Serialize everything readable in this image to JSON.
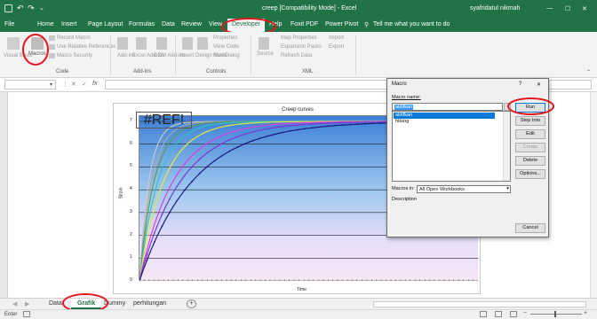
{
  "window": {
    "title": "creep [Compatibility Mode] - Excel",
    "user": "syafridatul nikmah"
  },
  "tabs": [
    "File",
    "Home",
    "Insert",
    "Page Layout",
    "Formulas",
    "Data",
    "Review",
    "View",
    "Developer",
    "Help",
    "Foxit PDF",
    "Power Pivot"
  ],
  "active_tab": "Developer",
  "tell_me": "Tell me what you want to do",
  "ribbon": {
    "code_group": {
      "label": "Code",
      "items": [
        "Visual Basic",
        "Macros",
        "Record Macro",
        "Use Relative References",
        "Macro Security"
      ]
    },
    "addins_group": {
      "label": "Add-ins",
      "items": [
        "Add-ins",
        "Excel Add-ins",
        "COM Add-ins"
      ]
    },
    "controls_group": {
      "label": "Controls",
      "items": [
        "Insert",
        "Design Mode",
        "Properties",
        "View Code",
        "Run Dialog"
      ]
    },
    "xml_group": {
      "label": "XML",
      "items": [
        "Source",
        "Map Properties",
        "Expansion Packs",
        "Refresh Data",
        "Import",
        "Export"
      ]
    }
  },
  "formula_bar": {
    "name_box": "",
    "fx": "fx"
  },
  "chart_data": {
    "type": "line",
    "title": "Creep curves",
    "xlabel": "Time",
    "ylabel": "Strain",
    "ylim": [
      0,
      7
    ],
    "yticks": [
      0,
      1,
      2,
      3,
      4,
      5,
      6,
      7
    ],
    "annotation": "#REF!",
    "series": [
      {
        "color": "#c8c8c8",
        "rate": 6.0
      },
      {
        "color": "#a8a8a8",
        "rate": 4.6
      },
      {
        "color": "#5a9a5a",
        "rate": 3.8
      },
      {
        "color": "#2ec4c4",
        "rate": 3.0
      },
      {
        "color": "#e8e83a",
        "rate": 2.3
      },
      {
        "color": "#e03ce0",
        "rate": 1.65
      },
      {
        "color": "#7a3ad0",
        "rate": 1.35
      },
      {
        "color": "#1b1b80",
        "rate": 1.05
      }
    ]
  },
  "sheet_tabs": [
    "Data",
    "Grafik",
    "Dummy",
    "perhitungan"
  ],
  "active_sheet": "Grafik",
  "status": {
    "mode": "Enter"
  },
  "macro_dialog": {
    "title": "Macro",
    "help": "?",
    "close": "✕",
    "macro_name_label": "Macro name:",
    "macro_name_value": "aktifkan",
    "macros": [
      "aktifkan",
      "hitung"
    ],
    "selected_macro": "aktifkan",
    "macros_in_label": "Macros in:",
    "macros_in_value": "All Open Workbooks",
    "description_label": "Description",
    "buttons": {
      "run": "Run",
      "step_into": "Step Into",
      "edit": "Edit",
      "create": "Create",
      "delete": "Delete",
      "options": "Options...",
      "cancel": "Cancel"
    }
  }
}
